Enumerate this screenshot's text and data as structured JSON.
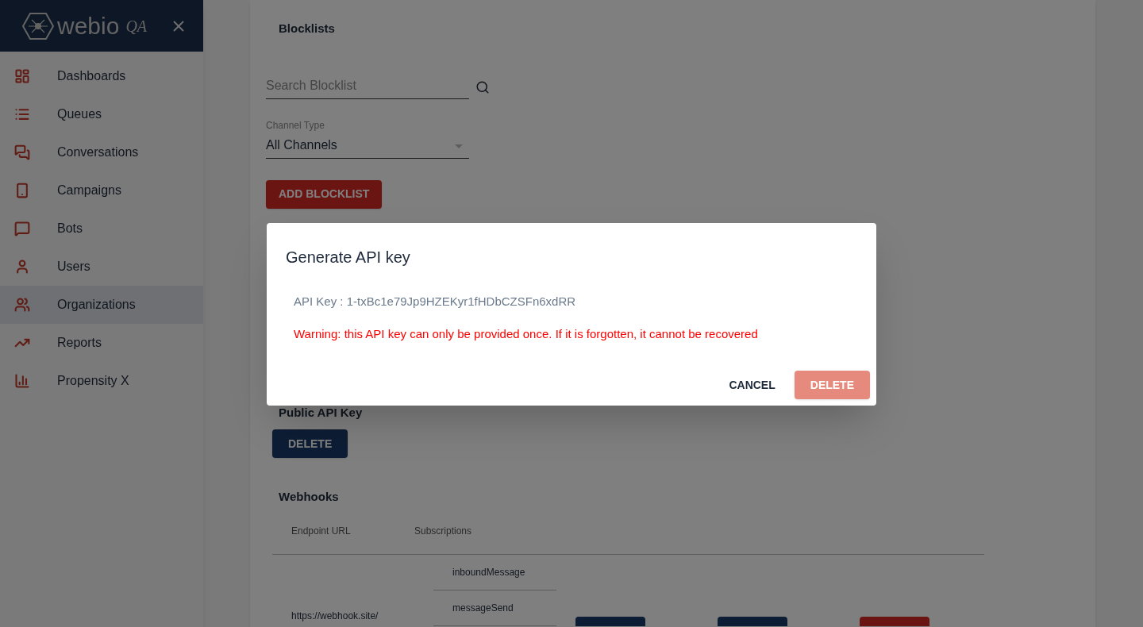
{
  "sidebar": {
    "logo": {
      "name": "webio",
      "tag": "QA"
    },
    "items": [
      {
        "label": "Dashboards",
        "kind": "dashboard",
        "selected": false
      },
      {
        "label": "Queues",
        "kind": "list",
        "selected": false
      },
      {
        "label": "Conversations",
        "kind": "chats",
        "selected": false
      },
      {
        "label": "Campaigns",
        "kind": "phone",
        "selected": false
      },
      {
        "label": "Bots",
        "kind": "message",
        "selected": false
      },
      {
        "label": "Users",
        "kind": "user",
        "selected": false
      },
      {
        "label": "Organizations",
        "kind": "users",
        "selected": true
      },
      {
        "label": "Reports",
        "kind": "trend",
        "selected": false
      },
      {
        "label": "Propensity X",
        "kind": "bars",
        "selected": false
      }
    ]
  },
  "blocklists": {
    "title": "Blocklists",
    "search": {
      "placeholder": "Search Blocklist"
    },
    "channel_type": {
      "label": "Channel Type",
      "value": "All Channels"
    },
    "add_button": "ADD BLOCKLIST"
  },
  "public_api_key": {
    "title": "Public API Key",
    "delete_button": "DELETE"
  },
  "webhooks": {
    "title": "Webhooks",
    "columns": [
      "Endpoint URL",
      "Subscriptions"
    ],
    "rows": [
      {
        "endpoint_url": "https://webhook.site/",
        "subscriptions": [
          "inboundMessage",
          "messageSend"
        ]
      }
    ]
  },
  "dialog": {
    "title": "Generate API key",
    "api_key": "API Key : 1-txBc1e79Jp9HZEKyr1fHDbCZSFn6xdRR",
    "warning": "Warning: this API key can only be provided once. If it is forgotten, it cannot be recovered",
    "buttons": [
      {
        "label": "CANCEL",
        "kind": "text"
      },
      {
        "label": "DELETE",
        "kind": "primary"
      }
    ]
  }
}
